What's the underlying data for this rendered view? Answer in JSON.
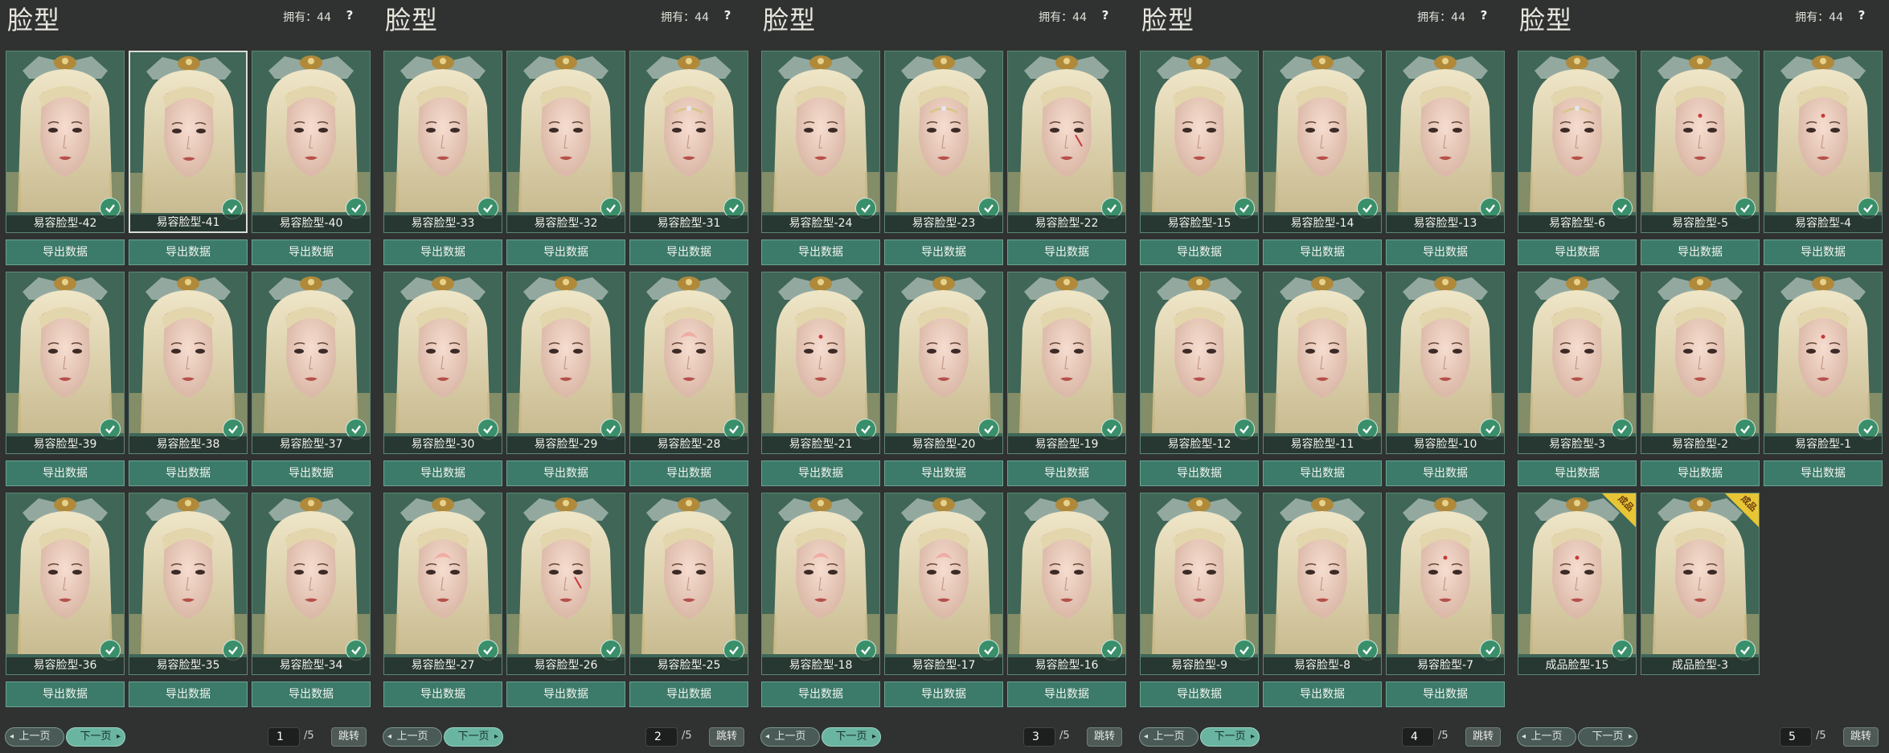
{
  "panels": [
    {
      "title": "脸型",
      "owned": "拥有：44",
      "help": "?",
      "cards": [
        {
          "name": "易容脸型-42",
          "export": "导出数据",
          "owned": true,
          "selected": false,
          "mark": "none"
        },
        {
          "name": "易容脸型-41",
          "export": "导出数据",
          "owned": true,
          "selected": true,
          "mark": "none"
        },
        {
          "name": "易容脸型-40",
          "export": "导出数据",
          "owned": true,
          "selected": false,
          "mark": "none"
        },
        {
          "name": "易容脸型-39",
          "export": "导出数据",
          "owned": true,
          "selected": false,
          "mark": "none"
        },
        {
          "name": "易容脸型-38",
          "export": "导出数据",
          "owned": true,
          "selected": false,
          "mark": "none"
        },
        {
          "name": "易容脸型-37",
          "export": "导出数据",
          "owned": true,
          "selected": false,
          "mark": "none"
        },
        {
          "name": "易容脸型-36",
          "export": "导出数据",
          "owned": true,
          "selected": false,
          "mark": "none"
        },
        {
          "name": "易容脸型-35",
          "export": "导出数据",
          "owned": true,
          "selected": false,
          "mark": "none"
        },
        {
          "name": "易容脸型-34",
          "export": "导出数据",
          "owned": true,
          "selected": false,
          "mark": "none"
        }
      ],
      "pager": {
        "prev": "上一页",
        "next": "下一页",
        "page": "1",
        "total": "/5",
        "jump": "跳转",
        "next_active": true
      }
    },
    {
      "title": "脸型",
      "owned": "拥有：44",
      "help": "?",
      "cards": [
        {
          "name": "易容脸型-33",
          "export": "导出数据",
          "owned": true,
          "selected": false,
          "mark": "none"
        },
        {
          "name": "易容脸型-32",
          "export": "导出数据",
          "owned": true,
          "selected": false,
          "mark": "none"
        },
        {
          "name": "易容脸型-31",
          "export": "导出数据",
          "owned": true,
          "selected": false,
          "mark": "crown"
        },
        {
          "name": "易容脸型-30",
          "export": "导出数据",
          "owned": true,
          "selected": false,
          "mark": "none"
        },
        {
          "name": "易容脸型-29",
          "export": "导出数据",
          "owned": true,
          "selected": false,
          "mark": "none"
        },
        {
          "name": "易容脸型-28",
          "export": "导出数据",
          "owned": true,
          "selected": false,
          "mark": "lotus"
        },
        {
          "name": "易容脸型-27",
          "export": "导出数据",
          "owned": true,
          "selected": false,
          "mark": "lotus"
        },
        {
          "name": "易容脸型-26",
          "export": "导出数据",
          "owned": true,
          "selected": false,
          "mark": "scar"
        },
        {
          "name": "易容脸型-25",
          "export": "导出数据",
          "owned": true,
          "selected": false,
          "mark": "none"
        }
      ],
      "pager": {
        "prev": "上一页",
        "next": "下一页",
        "page": "2",
        "total": "/5",
        "jump": "跳转",
        "next_active": true
      }
    },
    {
      "title": "脸型",
      "owned": "拥有：44",
      "help": "?",
      "cards": [
        {
          "name": "易容脸型-24",
          "export": "导出数据",
          "owned": true,
          "selected": false,
          "mark": "none"
        },
        {
          "name": "易容脸型-23",
          "export": "导出数据",
          "owned": true,
          "selected": false,
          "mark": "crown"
        },
        {
          "name": "易容脸型-22",
          "export": "导出数据",
          "owned": true,
          "selected": false,
          "mark": "scar"
        },
        {
          "name": "易容脸型-21",
          "export": "导出数据",
          "owned": true,
          "selected": false,
          "mark": "dot"
        },
        {
          "name": "易容脸型-20",
          "export": "导出数据",
          "owned": true,
          "selected": false,
          "mark": "none"
        },
        {
          "name": "易容脸型-19",
          "export": "导出数据",
          "owned": true,
          "selected": false,
          "mark": "none"
        },
        {
          "name": "易容脸型-18",
          "export": "导出数据",
          "owned": true,
          "selected": false,
          "mark": "lotus"
        },
        {
          "name": "易容脸型-17",
          "export": "导出数据",
          "owned": true,
          "selected": false,
          "mark": "lotus"
        },
        {
          "name": "易容脸型-16",
          "export": "导出数据",
          "owned": true,
          "selected": false,
          "mark": "none"
        }
      ],
      "pager": {
        "prev": "上一页",
        "next": "下一页",
        "page": "3",
        "total": "/5",
        "jump": "跳转",
        "next_active": true
      }
    },
    {
      "title": "脸型",
      "owned": "拥有：44",
      "help": "?",
      "cards": [
        {
          "name": "易容脸型-15",
          "export": "导出数据",
          "owned": true,
          "selected": false,
          "mark": "none"
        },
        {
          "name": "易容脸型-14",
          "export": "导出数据",
          "owned": true,
          "selected": false,
          "mark": "none"
        },
        {
          "name": "易容脸型-13",
          "export": "导出数据",
          "owned": true,
          "selected": false,
          "mark": "none"
        },
        {
          "name": "易容脸型-12",
          "export": "导出数据",
          "owned": true,
          "selected": false,
          "mark": "none"
        },
        {
          "name": "易容脸型-11",
          "export": "导出数据",
          "owned": true,
          "selected": false,
          "mark": "none"
        },
        {
          "name": "易容脸型-10",
          "export": "导出数据",
          "owned": true,
          "selected": false,
          "mark": "none"
        },
        {
          "name": "易容脸型-9",
          "export": "导出数据",
          "owned": true,
          "selected": false,
          "mark": "none"
        },
        {
          "name": "易容脸型-8",
          "export": "导出数据",
          "owned": true,
          "selected": false,
          "mark": "none"
        },
        {
          "name": "易容脸型-7",
          "export": "导出数据",
          "owned": true,
          "selected": false,
          "mark": "dot"
        }
      ],
      "pager": {
        "prev": "上一页",
        "next": "下一页",
        "page": "4",
        "total": "/5",
        "jump": "跳转",
        "next_active": true
      }
    },
    {
      "title": "脸型",
      "owned": "拥有：44",
      "help": "?",
      "cards": [
        {
          "name": "易容脸型-6",
          "export": "导出数据",
          "owned": true,
          "selected": false,
          "mark": "crown"
        },
        {
          "name": "易容脸型-5",
          "export": "导出数据",
          "owned": true,
          "selected": false,
          "mark": "dot"
        },
        {
          "name": "易容脸型-4",
          "export": "导出数据",
          "owned": true,
          "selected": false,
          "mark": "dot"
        },
        {
          "name": "易容脸型-3",
          "export": "导出数据",
          "owned": true,
          "selected": false,
          "mark": "none"
        },
        {
          "name": "易容脸型-2",
          "export": "导出数据",
          "owned": true,
          "selected": false,
          "mark": "none"
        },
        {
          "name": "易容脸型-1",
          "export": "导出数据",
          "owned": true,
          "selected": false,
          "mark": "dot"
        },
        {
          "name": "成品脸型-15",
          "export": "",
          "owned": true,
          "selected": false,
          "mark": "dot",
          "badge": "成品"
        },
        {
          "name": "成品脸型-3",
          "export": "",
          "owned": true,
          "selected": false,
          "mark": "none",
          "badge": "成品"
        }
      ],
      "pager": {
        "prev": "上一页",
        "next": "下一页",
        "page": "5",
        "total": "/5",
        "jump": "跳转",
        "next_active": false
      }
    }
  ],
  "colors": {
    "background": "#2f3231",
    "card_bg": "#3f6657",
    "button": "#3c7a69",
    "check": "#3a8f6b",
    "badge": "#e8c534",
    "pager_active": "#6ab5a1"
  }
}
